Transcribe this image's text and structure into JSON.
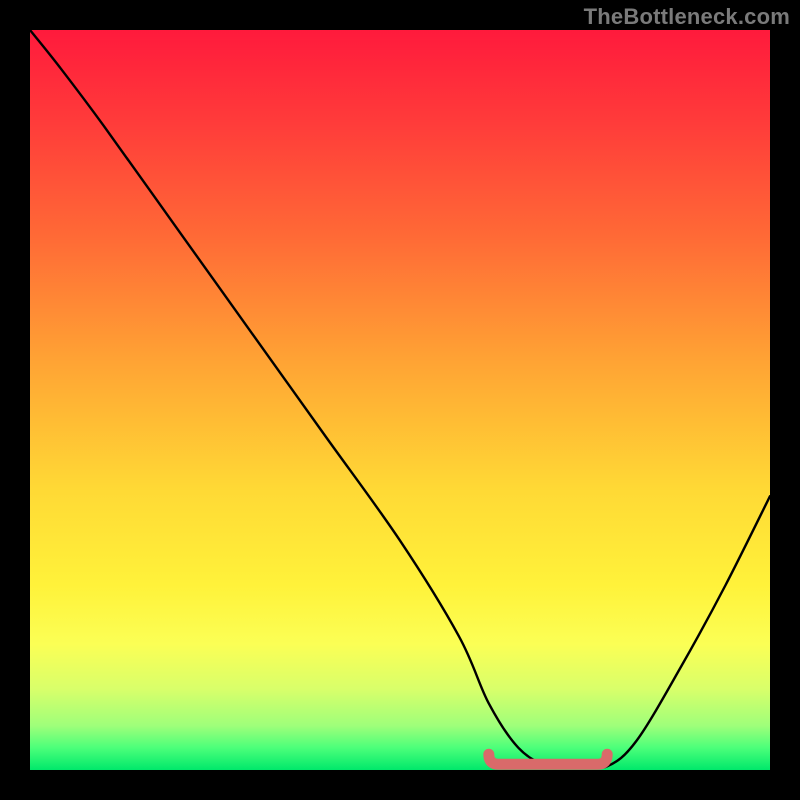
{
  "watermark": "TheBottleneck.com",
  "colors": {
    "frame": "#000000",
    "curve": "#000000",
    "marker": "#d96a6a",
    "gradient_top": "#ff1a3c",
    "gradient_bottom": "#00e86b"
  },
  "chart_data": {
    "type": "line",
    "title": "",
    "xlabel": "",
    "ylabel": "",
    "xlim": [
      0,
      100
    ],
    "ylim": [
      0,
      100
    ],
    "x": [
      0,
      4,
      10,
      20,
      30,
      40,
      50,
      58,
      62,
      66,
      70,
      74,
      78,
      82,
      88,
      94,
      100
    ],
    "values": [
      100,
      95,
      87,
      73,
      59,
      45,
      31,
      18,
      9,
      3,
      0.5,
      0.5,
      0.5,
      4,
      14,
      25,
      37
    ],
    "flat_region": {
      "x_start": 62,
      "x_end": 78,
      "y": 0.5
    },
    "note": "Values read from vertical position; 0 = bottom (green), 100 = top (red). No axis ticks or labels are shown in the image."
  }
}
